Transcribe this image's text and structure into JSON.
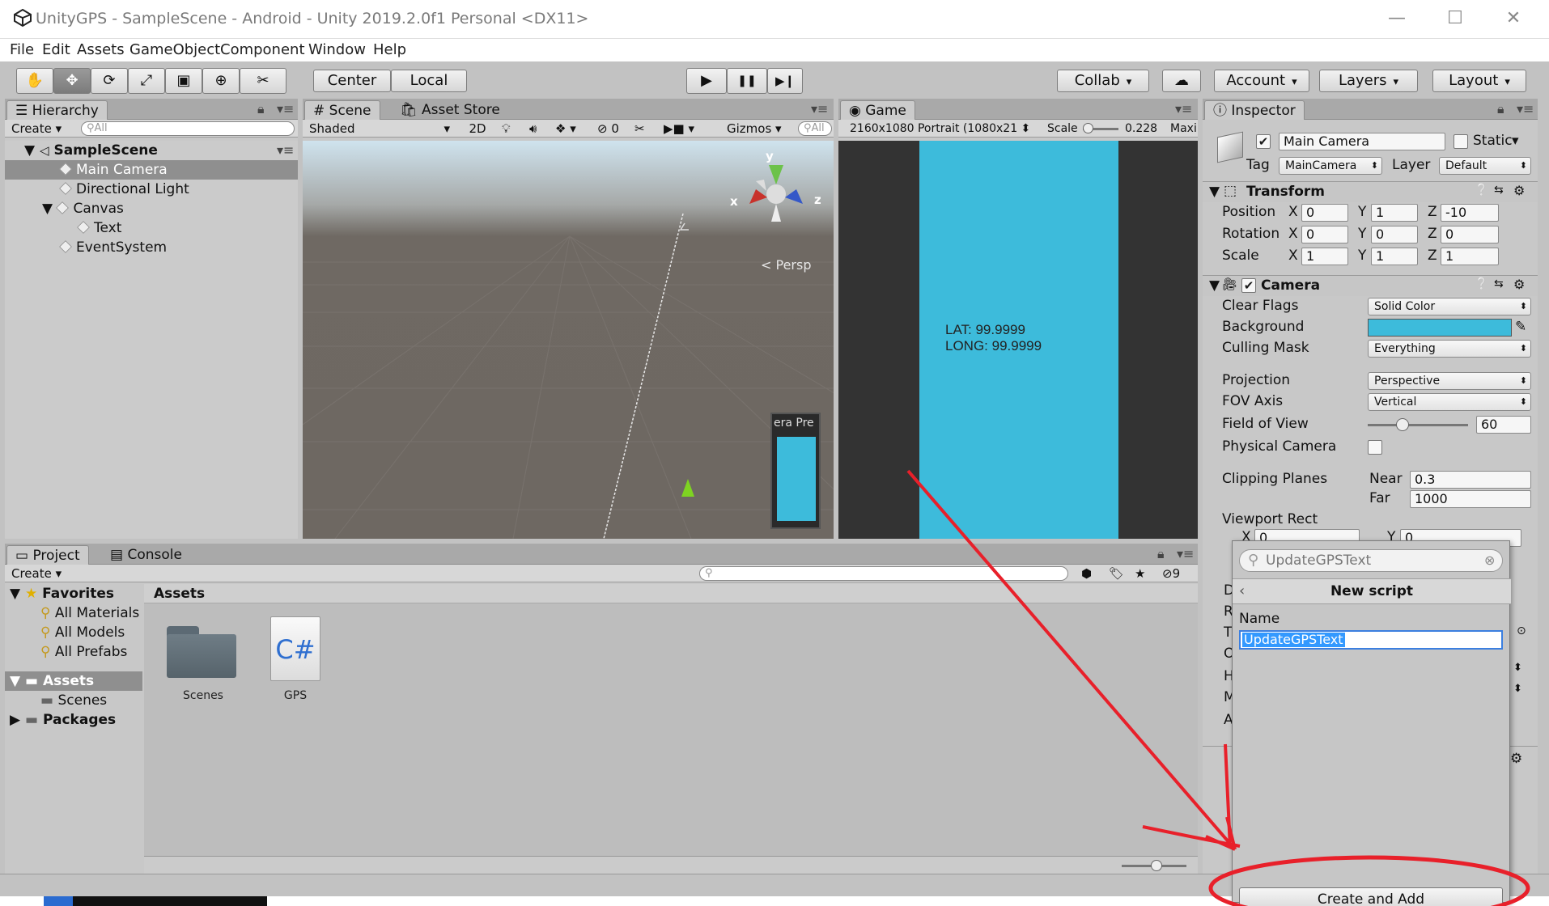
{
  "window": {
    "title": "UnityGPS - SampleScene - Android - Unity 2019.2.0f1 Personal <DX11>",
    "minimize": "—",
    "maximize": "☐",
    "close": "✕"
  },
  "menu": [
    "File",
    "Edit",
    "Assets",
    "GameObject",
    "Component",
    "Window",
    "Help"
  ],
  "toolbar": {
    "tools": [
      "hand-icon",
      "move-icon",
      "rotate-icon",
      "scale-icon",
      "rect-icon",
      "transform-icon",
      "custom-tool-icon"
    ],
    "pivot": "Center",
    "space": "Local",
    "play": "▶",
    "pause": "❚❚",
    "step": "▶❙",
    "collab": "Collab",
    "account": "Account",
    "layers": "Layers",
    "layout": "Layout"
  },
  "hierarchy": {
    "tab": "Hierarchy",
    "create": "Create",
    "search_placeholder": "All",
    "scene": "SampleScene",
    "items": [
      {
        "label": "Main Camera",
        "indent": 1
      },
      {
        "label": "Directional Light",
        "indent": 1
      },
      {
        "label": "Canvas",
        "indent": 1
      },
      {
        "label": "Text",
        "indent": 2
      },
      {
        "label": "EventSystem",
        "indent": 1
      }
    ]
  },
  "scene": {
    "tab": "Scene",
    "tab2": "Asset Store",
    "shading": "Shaded",
    "mode2d": "2D",
    "hidden_count": "0",
    "gizmos": "Gizmos",
    "search_placeholder": "All",
    "persp": "Persp",
    "camera_preview": "era Pre",
    "axis_x": "x",
    "axis_y": "y",
    "axis_z": "z"
  },
  "game": {
    "tab": "Game",
    "resolution": "2160x1080 Portrait (1080x21",
    "scale_label": "Scale",
    "scale_value": "0.228",
    "maximize": "Maxir",
    "lat": "LAT: 99.9999",
    "long": "LONG: 99.9999"
  },
  "inspector": {
    "tab": "Inspector",
    "object_name": "Main Camera",
    "static": "Static",
    "tag_label": "Tag",
    "tag": "MainCamera",
    "layer_label": "Layer",
    "layer": "Default",
    "transform": {
      "title": "Transform",
      "rows": [
        {
          "label": "Position",
          "x": "0",
          "y": "1",
          "z": "-10"
        },
        {
          "label": "Rotation",
          "x": "0",
          "y": "0",
          "z": "0"
        },
        {
          "label": "Scale",
          "x": "1",
          "y": "1",
          "z": "1"
        }
      ]
    },
    "camera": {
      "title": "Camera",
      "clear_flags_label": "Clear Flags",
      "clear_flags": "Solid Color",
      "background_label": "Background",
      "background_color": "#3dbbdb",
      "culling_mask_label": "Culling Mask",
      "culling_mask": "Everything",
      "projection_label": "Projection",
      "projection": "Perspective",
      "fov_axis_label": "FOV Axis",
      "fov_axis": "Vertical",
      "fov_label": "Field of View",
      "fov": "60",
      "fov_fraction": 0.35,
      "physical_label": "Physical Camera",
      "clipping_label": "Clipping Planes",
      "near_label": "Near",
      "near": "0.3",
      "far_label": "Far",
      "far": "1000",
      "viewport_label": "Viewport Rect",
      "vp_x_label": "X",
      "vp_x": "0",
      "vp_y_label": "Y",
      "vp_y": "0",
      "cut_letters": [
        "D",
        "R",
        "T",
        "O",
        "H",
        "M",
        "A"
      ]
    }
  },
  "popup": {
    "search_value": "UpdateGPSText",
    "title": "New script",
    "name_label": "Name",
    "name_value": "UpdateGPSText",
    "create_button": "Create and Add"
  },
  "project": {
    "tab": "Project",
    "tab2": "Console",
    "create": "Create",
    "hidden_count": "9",
    "favorites": "Favorites",
    "fav_items": [
      "All Materials",
      "All Models",
      "All Prefabs"
    ],
    "assets_root": "Assets",
    "assets_child": "Scenes",
    "packages": "Packages",
    "breadcrumb": "Assets",
    "files": [
      {
        "label": "Scenes",
        "kind": "folder"
      },
      {
        "label": "GPS",
        "kind": "script",
        "glyph": "C#"
      }
    ]
  },
  "colors": {
    "game_bg": "#3dbbdb",
    "scene_floor": "#6e6862",
    "annotation": "#e8202a"
  }
}
